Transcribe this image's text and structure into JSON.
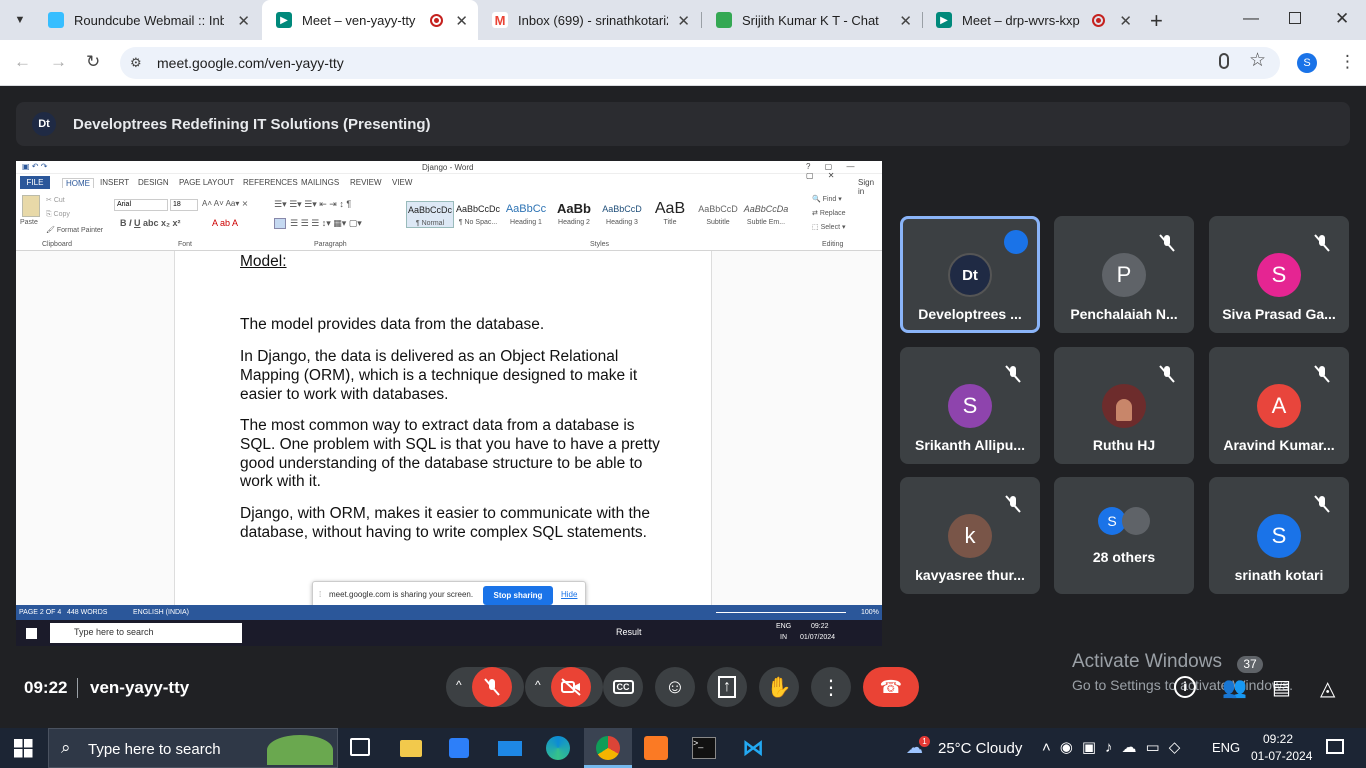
{
  "browser": {
    "tabs": [
      {
        "title": "Roundcube Webmail :: Inbox",
        "icon": "roundcube-icon",
        "color": "#37beff"
      },
      {
        "title": "Meet – ven-yayy-tty",
        "icon": "google-meet-icon",
        "color": "#00897b"
      },
      {
        "title": "Inbox (699) - srinathkotari20",
        "icon": "gmail-icon",
        "color": "#ea4335"
      },
      {
        "title": "Srijith Kumar K T - Chat",
        "icon": "google-chat-icon",
        "color": "#34a853"
      },
      {
        "title": "Meet – drp-wvrs-kxp",
        "icon": "google-meet-icon",
        "color": "#00897b"
      }
    ],
    "url": "meet.google.com/ven-yayy-tty",
    "profile_initial": "S"
  },
  "meet": {
    "presenting_title": "Developtrees Redefining IT Solutions (Presenting)",
    "time": "09:22",
    "meeting_code": "ven-yayy-tty",
    "participants": [
      {
        "name": "Developtrees ...",
        "initial": "Dt",
        "color": "#1f2a44",
        "speaking": true
      },
      {
        "name": "Penchalaiah N...",
        "initial": "P",
        "color": "#5f6368"
      },
      {
        "name": "Siva Prasad Ga...",
        "initial": "S",
        "color": "#e52592"
      },
      {
        "name": "Srikanth Allipu...",
        "initial": "S",
        "color": "#8e44ad"
      },
      {
        "name": "Ruthu HJ",
        "initial": "",
        "color": "#6d2c2c"
      },
      {
        "name": "Aravind Kumar...",
        "initial": "A",
        "color": "#e8453c"
      },
      {
        "name": "kavyasree thur...",
        "initial": "k",
        "color": "#795548"
      },
      {
        "name": "28 others",
        "initial": "S",
        "color": "#1a73e8"
      },
      {
        "name": "srinath kotari",
        "initial": "S",
        "color": "#1a73e8"
      }
    ],
    "activate_title": "Activate Windows",
    "activate_sub": "Go to Settings to activate Windows.",
    "chat_badge": "37"
  },
  "word": {
    "title": "Django - Word",
    "ribbon_tabs": [
      "FILE",
      "HOME",
      "INSERT",
      "DESIGN",
      "PAGE LAYOUT",
      "REFERENCES",
      "MAILINGS",
      "REVIEW",
      "VIEW"
    ],
    "sign_in": "Sign in",
    "font": "Arial",
    "font_size": "18",
    "styles": [
      {
        "sample": "AaBbCcDc",
        "name": "¶ Normal"
      },
      {
        "sample": "AaBbCcDc",
        "name": "¶ No Spac..."
      },
      {
        "sample": "AaBbCc",
        "name": "Heading 1"
      },
      {
        "sample": "AaBb",
        "name": "Heading 2"
      },
      {
        "sample": "AaBbCcD",
        "name": "Heading 3"
      },
      {
        "sample": "AaB",
        "name": "Title"
      },
      {
        "sample": "AaBbCcD",
        "name": "Subtitle"
      },
      {
        "sample": "AaBbCcDa",
        "name": "Subtle Em..."
      }
    ],
    "groups": [
      "Clipboard",
      "Font",
      "Paragraph",
      "Styles",
      "Editing"
    ],
    "clipboard": [
      "Cut",
      "Copy",
      "Format Painter",
      "Paste"
    ],
    "editing": [
      "Find",
      "Replace",
      "Select"
    ],
    "doc": {
      "heading": "Model:",
      "p1": "The model provides data from the database.",
      "p2": "In Django, the data is delivered as an Object Relational Mapping (ORM), which is a technique designed to make it easier to work with databases.",
      "p3": "The most common way to extract data from a database is SQL. One problem with SQL is that you have to have a pretty good understanding of the database structure to be able to work with it.",
      "p4": "Django, with ORM, makes it easier to communicate with the database, without having to write complex SQL statements."
    },
    "status": {
      "page": "PAGE 2 OF 4",
      "words": "448 WORDS",
      "lang": "ENGLISH (INDIA)",
      "zoom": "100%"
    },
    "share": {
      "text": "meet.google.com is sharing your screen.",
      "stop": "Stop sharing",
      "hide": "Hide"
    }
  },
  "inner_taskbar": {
    "search": "Type here to search",
    "result": "Result",
    "lang1": "ENG",
    "lang2": "IN",
    "time": "09:22",
    "date": "01/07/2024"
  },
  "taskbar": {
    "search": "Type here to search",
    "weather": "25°C  Cloudy",
    "weather_badge": "1",
    "lang": "ENG",
    "time": "09:22",
    "date": "01-07-2024"
  }
}
